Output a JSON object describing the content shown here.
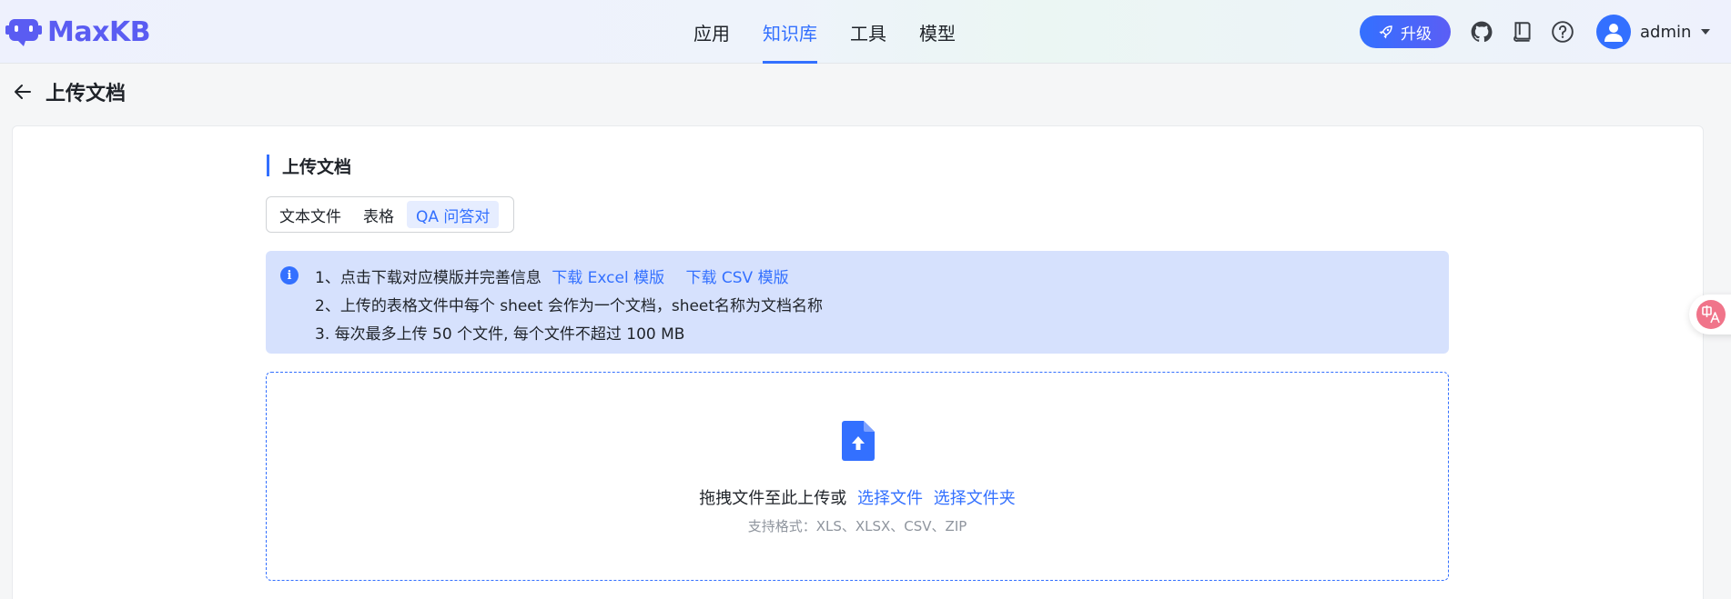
{
  "app": {
    "logo_text": "MaxKB"
  },
  "nav": {
    "items": [
      "应用",
      "知识库",
      "工具",
      "模型"
    ],
    "active_index": 1
  },
  "header": {
    "upgrade_label": "升级",
    "user_name": "admin"
  },
  "page": {
    "title": "上传文档"
  },
  "section": {
    "title": "上传文档"
  },
  "tabs": {
    "items": [
      "文本文件",
      "表格",
      "QA 问答对"
    ],
    "active_index": 2
  },
  "notice": {
    "line1_text": "1、点击下载对应模版并完善信息",
    "excel_link": "下载 Excel 模版",
    "csv_link": "下载 CSV 模版",
    "line2": "2、上传的表格文件中每个 sheet 会作为一个文档，sheet名称为文档名称",
    "line3": "3. 每次最多上传 50 个文件, 每个文件不超过 100 MB"
  },
  "dropzone": {
    "text": "拖拽文件至此上传或",
    "select_file": "选择文件",
    "select_folder": "选择文件夹",
    "hint": "支持格式：XLS、XLSX、CSV、ZIP"
  },
  "colors": {
    "accent": "#3370ff",
    "brand": "#5a5cf2",
    "notice_bg": "#d6e1fd"
  }
}
